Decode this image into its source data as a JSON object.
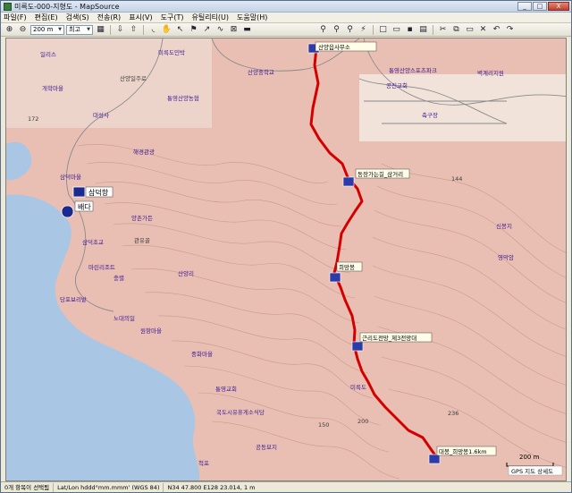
{
  "window": {
    "title": "미륵도-000-지형도 - MapSource",
    "min": "_",
    "max": "□",
    "close": "X"
  },
  "menu": [
    {
      "label": "파일(F)"
    },
    {
      "label": "편집(E)"
    },
    {
      "label": "검색(S)"
    },
    {
      "label": "전송(R)"
    },
    {
      "label": "표시(V)"
    },
    {
      "label": "도구(T)"
    },
    {
      "label": "유틸리티(U)"
    },
    {
      "label": "도움말(H)"
    }
  ],
  "toolbar": {
    "zoom_value": "200 m",
    "detail_value": "최고"
  },
  "map": {
    "scale_label": "200 m",
    "overlay_label": "GPS 지도 상세도",
    "waypoints": [
      {
        "label": "산양읍사무소"
      },
      {
        "label": "동장가는길_삼거리"
      },
      {
        "label": "희망봉"
      },
      {
        "label": "근리도전망_제3전망대"
      },
      {
        "label": "대봉_희망봉1.6km"
      }
    ],
    "labels": {
      "stop1": "삼덕항",
      "stop2": "배다",
      "sanyang_road": "산양일주로",
      "road2": "관유골",
      "elev1": "172",
      "elev2": "144",
      "elev3": "150",
      "elev4": "236",
      "contour1": "200",
      "sports_park": "통영산양스포츠파크",
      "field": "축구장",
      "church": "통영교회",
      "cemetery": "공동묘지",
      "peak_sign": "미륵도",
      "poi_a": "미륵도민박",
      "poi_b": "마린리조트",
      "poi_c": "당포보리밭",
      "poi_d": "삼덕초교",
      "poi_e": "통영산양농협",
      "poi_f": "산양중학교",
      "poi_g": "중화마을",
      "poi_h": "국도시유휴게소식당",
      "poi_i": "척포",
      "poi_j": "노대의일",
      "poi_k": "산양리",
      "poi_l": "원항마을",
      "poi_m": "대성사",
      "poi_n": "양촌가든",
      "poi_o": "충렬",
      "poi_p": "신봉지",
      "poi_q": "영막암",
      "poi_r": "개학마을",
      "poi_s": "해경관광",
      "poi_t": "일리스",
      "poi_u": "공진교회",
      "poi_v": "벽계리지원",
      "poi_w": "삼덕마을"
    }
  },
  "status": {
    "selection": "0개 항목이 선택됨",
    "format": "Lat/Lon hddd°mm.mmm' (WGS 84)",
    "coords": "N34 47.800 E128 23.014, 1 m"
  },
  "colors": {
    "terrain": "#e9bfb3",
    "water": "#a9c6e4",
    "track": "#d40000",
    "poi_text": "#3a1a96"
  }
}
